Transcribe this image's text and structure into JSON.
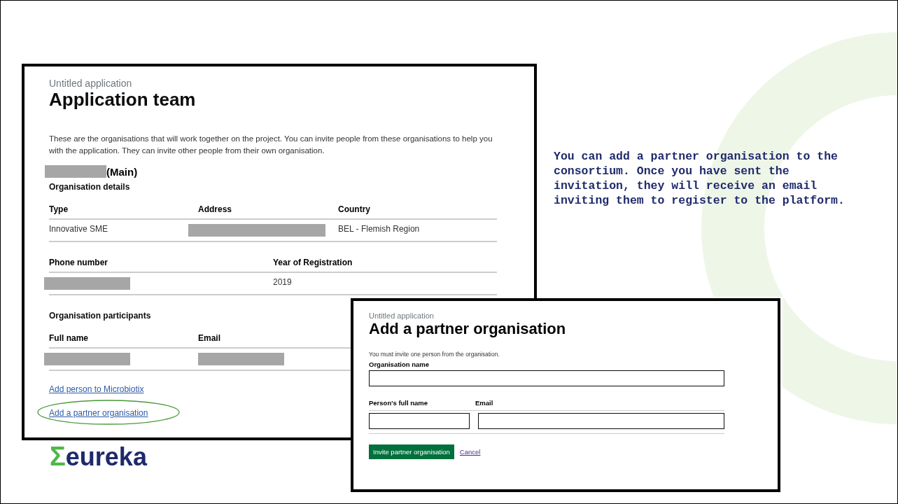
{
  "main_screen": {
    "caption": "Untitled application",
    "title": "Application team",
    "intro": "These are the organisations that will work together on the project. You can invite people from these organisations to help you with the application. They can invite other people from their own organisation.",
    "organisation_suffix": "(Main)",
    "details_heading": "Organisation details",
    "details_table": {
      "columns": [
        "Type",
        "Address",
        "Country"
      ],
      "rows": [
        [
          "Innovative SME",
          null,
          "BEL - Flemish Region"
        ]
      ]
    },
    "contact_table": {
      "columns": [
        "Phone number",
        "Year of Registration"
      ],
      "rows": [
        [
          null,
          "2019"
        ]
      ]
    },
    "participants_heading": "Organisation participants",
    "participants_table": {
      "columns": [
        "Full name",
        "Email"
      ],
      "rows": [
        [
          null,
          null
        ]
      ]
    },
    "links": [
      {
        "text": "Add person to Microbiotix",
        "circled": false
      },
      {
        "text": "Add a partner organisation",
        "circled": true
      }
    ]
  },
  "note": "You can add a partner organisation to the consortium. Once you have sent the invitation, they will receive an email inviting them to register to the platform.",
  "logo": {
    "symbol": "Σ",
    "name": "eureka"
  },
  "partner_screen": {
    "caption": "Untitled application",
    "title": "Add a partner organisation",
    "hint": "You must invite one person from the organisation.",
    "organisation_label": "Organisation name",
    "person_label": "Person's full name",
    "email_label": "Email",
    "submit": "Invite partner organisation",
    "cancel": "Cancel"
  }
}
